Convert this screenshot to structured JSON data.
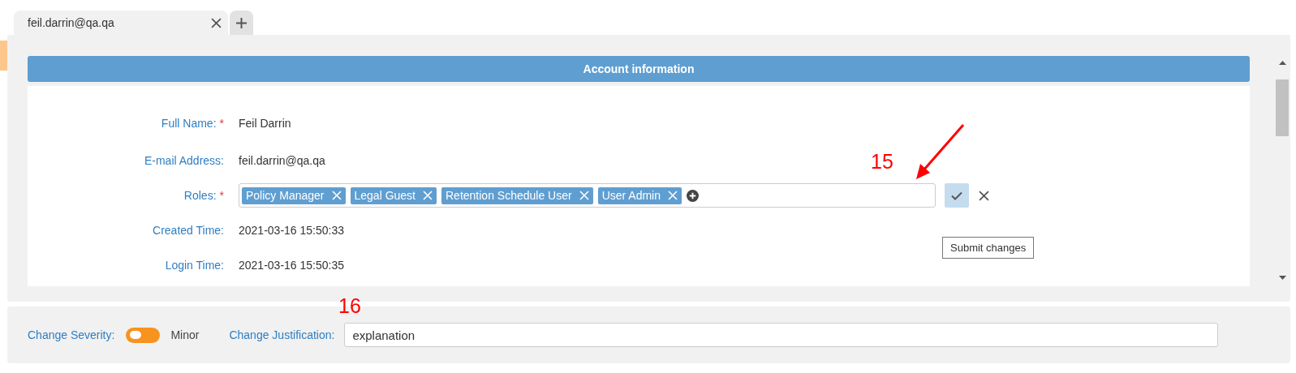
{
  "tabs": [
    {
      "label": "feil.darrin@qa.qa",
      "selected": true
    }
  ],
  "section_title": "Account information",
  "fields": [
    {
      "kind": "text",
      "label": "Full Name:",
      "marker": "*",
      "value": "Feil Darrin"
    },
    {
      "kind": "text",
      "label": "E-mail Address:",
      "value": "feil.darrin@qa.qa"
    },
    {
      "kind": "roles",
      "label": "Roles:",
      "marker": "*",
      "roles": [
        "Policy Manager",
        "Legal Guest",
        "Retention Schedule User",
        "User Admin"
      ],
      "tooltip": "Submit changes"
    },
    {
      "kind": "text",
      "label": "Created Time:",
      "value": "2021-03-16 15:50:33"
    },
    {
      "kind": "text",
      "label": "Login Time:",
      "value": "2021-03-16 15:50:35"
    }
  ],
  "footer": {
    "severity_label": "Change Severity:",
    "severity_on": false,
    "severity_value": "Minor",
    "justification_label": "Change Justification:",
    "justification_value": "explanation"
  },
  "annotations": [
    "15",
    "16"
  ]
}
